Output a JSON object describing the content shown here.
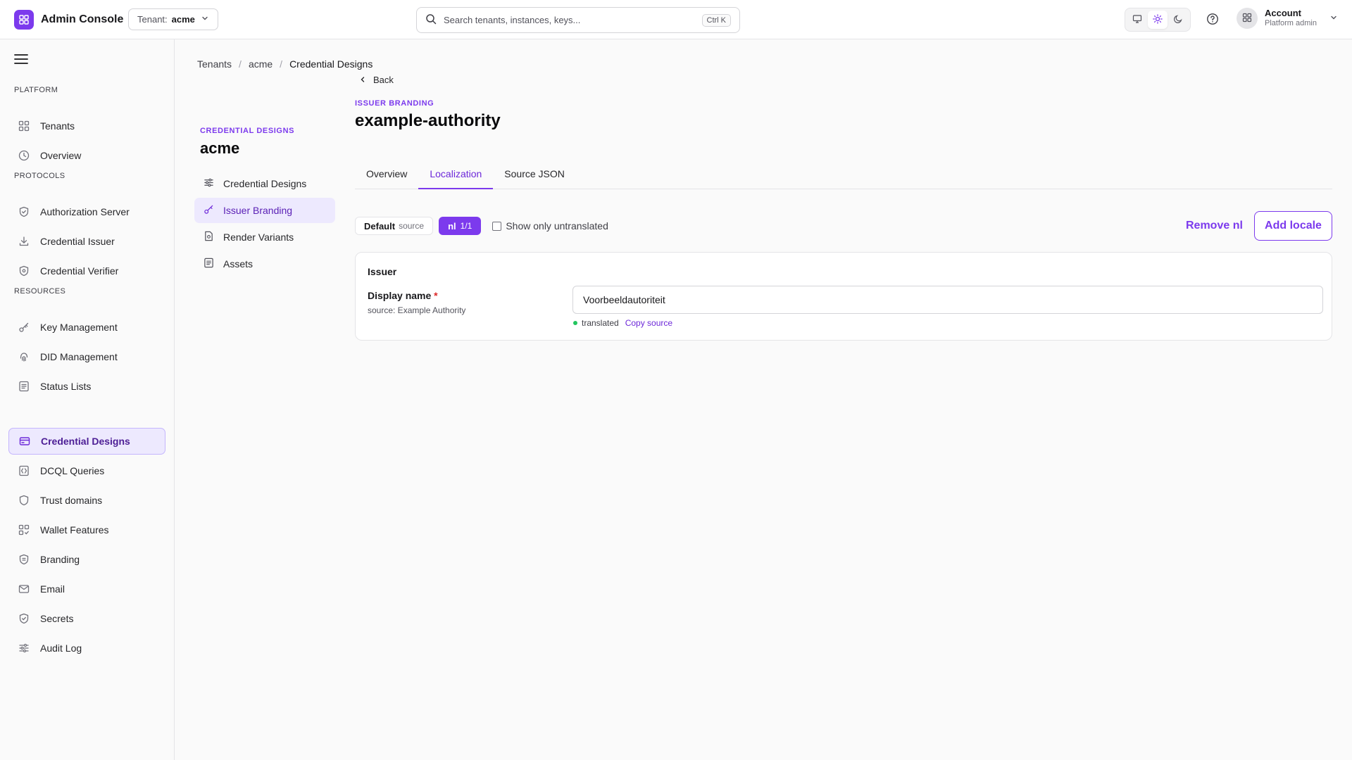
{
  "app": {
    "title": "Admin Console"
  },
  "tenant": {
    "label": "Tenant:",
    "value": "acme"
  },
  "search": {
    "placeholder": "Search tenants, instances, keys...",
    "shortcut": "Ctrl K"
  },
  "theme": {
    "options": [
      "system",
      "light",
      "dark"
    ],
    "selected": "light"
  },
  "account": {
    "name": "Account",
    "role": "Platform admin"
  },
  "sidebar": {
    "sections": [
      {
        "label": "PLATFORM",
        "items": [
          {
            "label": "Tenants",
            "icon": "grid-icon"
          },
          {
            "label": "Overview",
            "icon": "clock-icon"
          }
        ]
      },
      {
        "label": "PROTOCOLS",
        "items": [
          {
            "label": "Authorization Server",
            "icon": "shield-icon"
          },
          {
            "label": "Credential Issuer",
            "icon": "download-icon"
          },
          {
            "label": "Credential Verifier",
            "icon": "shield-icon"
          }
        ]
      },
      {
        "label": "RESOURCES",
        "items": [
          {
            "label": "Key Management",
            "icon": "key-icon"
          },
          {
            "label": "DID Management",
            "icon": "fingerprint-icon"
          },
          {
            "label": "Status Lists",
            "icon": "list-icon"
          },
          {
            "label": "Credential Designs",
            "icon": "card-icon",
            "active": true
          },
          {
            "label": "DCQL Queries",
            "icon": "query-icon"
          },
          {
            "label": "Trust domains",
            "icon": "shield-icon"
          },
          {
            "label": "Wallet Features",
            "icon": "grid-icon"
          },
          {
            "label": "Branding",
            "icon": "badge-icon"
          },
          {
            "label": "Email",
            "icon": "mail-icon"
          },
          {
            "label": "Secrets",
            "icon": "shield-icon"
          },
          {
            "label": "Audit Log",
            "icon": "sliders-icon"
          }
        ]
      }
    ]
  },
  "breadcrumb": [
    "Tenants",
    "acme",
    "Credential Designs"
  ],
  "secondary_nav": {
    "eyebrow": "CREDENTIAL DESIGNS",
    "title": "acme",
    "items": [
      {
        "label": "Credential Designs",
        "icon": "sliders-icon"
      },
      {
        "label": "Issuer Branding",
        "icon": "key-icon",
        "active": true
      },
      {
        "label": "Render Variants",
        "icon": "file-icon"
      },
      {
        "label": "Assets",
        "icon": "list-icon"
      }
    ]
  },
  "main": {
    "back_label": "Back",
    "eyebrow": "ISSUER BRANDING",
    "title": "example-authority",
    "tabs": [
      {
        "label": "Overview"
      },
      {
        "label": "Localization",
        "active": true
      },
      {
        "label": "Source JSON"
      }
    ],
    "locales": {
      "default_label": "Default",
      "default_sub": "source",
      "active_locale": "nl",
      "active_count": "1/1",
      "show_untranslated_label": "Show only untranslated",
      "show_untranslated_checked": false
    },
    "actions": {
      "remove_label": "Remove nl",
      "add_label": "Add locale"
    },
    "section": {
      "heading": "Issuer",
      "field": {
        "label": "Display name",
        "required_mark": "*",
        "source_text": "source: Example Authority",
        "value": "Voorbeeldautoriteit",
        "status": "translated",
        "copy_label": "Copy source"
      }
    }
  },
  "colors": {
    "accent": "#7c3aed",
    "accent_bg": "#ede9fe",
    "status_ok": "#22c55e"
  }
}
